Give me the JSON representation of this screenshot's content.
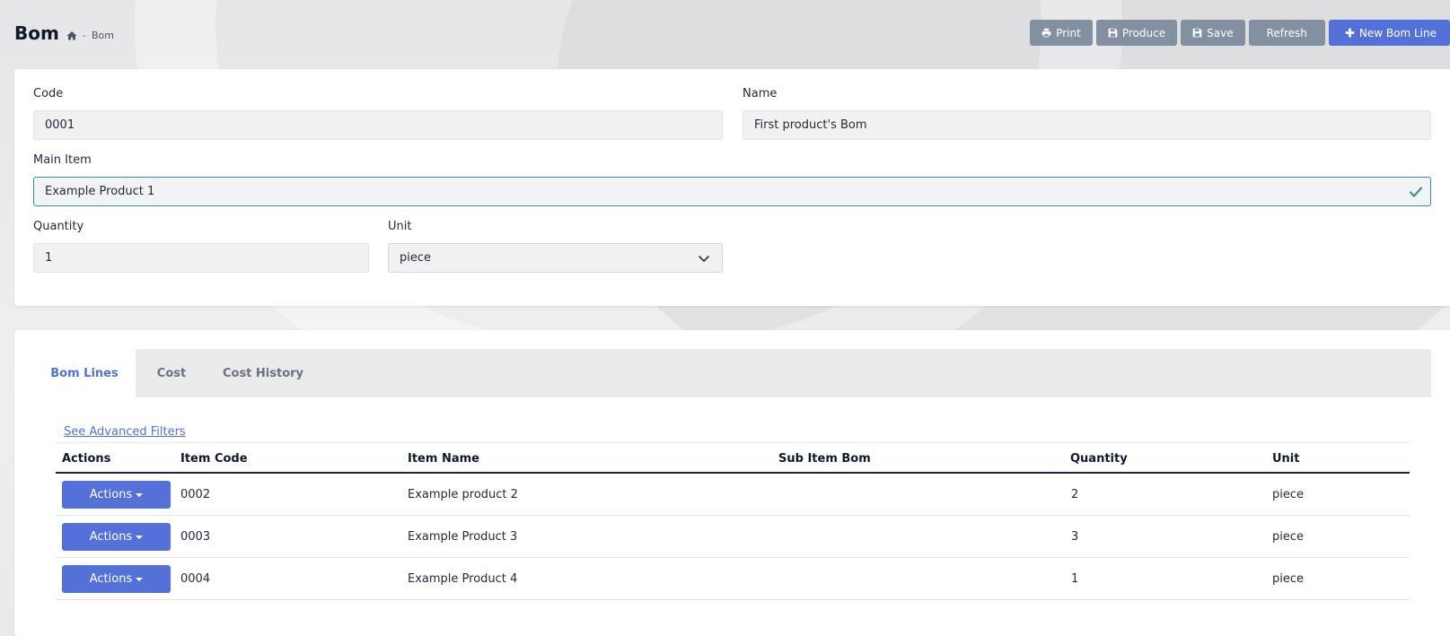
{
  "header": {
    "title": "Bom",
    "breadcrumb": {
      "separator": "-",
      "current": "Bom"
    }
  },
  "toolbar": {
    "print_label": "Print",
    "produce_label": "Produce",
    "save_label": "Save",
    "refresh_label": "Refresh",
    "new_line_label": "New Bom Line"
  },
  "form": {
    "code_label": "Code",
    "code_value": "0001",
    "name_label": "Name",
    "name_value": "First product's Bom",
    "main_item_label": "Main Item",
    "main_item_value": "Example Product 1",
    "quantity_label": "Quantity",
    "quantity_value": "1",
    "unit_label": "Unit",
    "unit_value": "piece"
  },
  "tabs": [
    {
      "label": "Bom Lines",
      "active": true
    },
    {
      "label": "Cost",
      "active": false
    },
    {
      "label": "Cost History",
      "active": false
    }
  ],
  "lines": {
    "advanced_filters_label": "See Advanced Filters",
    "columns": [
      "Actions",
      "Item Code",
      "Item Name",
      "Sub Item Bom",
      "Quantity",
      "Unit"
    ],
    "actions_button_label": "Actions",
    "rows": [
      {
        "item_code": "0002",
        "item_name": "Example product 2",
        "sub_item_bom": "",
        "quantity": "2",
        "unit": "piece"
      },
      {
        "item_code": "0003",
        "item_name": "Example Product 3",
        "sub_item_bom": "",
        "quantity": "3",
        "unit": "piece"
      },
      {
        "item_code": "0004",
        "item_name": "Example Product 4",
        "sub_item_bom": "",
        "quantity": "1",
        "unit": "piece"
      }
    ]
  },
  "colors": {
    "primary": "#5470d9",
    "secondary_button": "#8390a1",
    "valid_border": "#3c8c9c",
    "table_header_rule": "#1e2440"
  },
  "icons": {
    "breadcrumb_home": "home-icon",
    "print": "printer-icon",
    "produce": "save-disk-icon",
    "save": "save-disk-icon",
    "new": "plus-icon",
    "valid": "check-icon",
    "select": "chevron-down-icon"
  }
}
